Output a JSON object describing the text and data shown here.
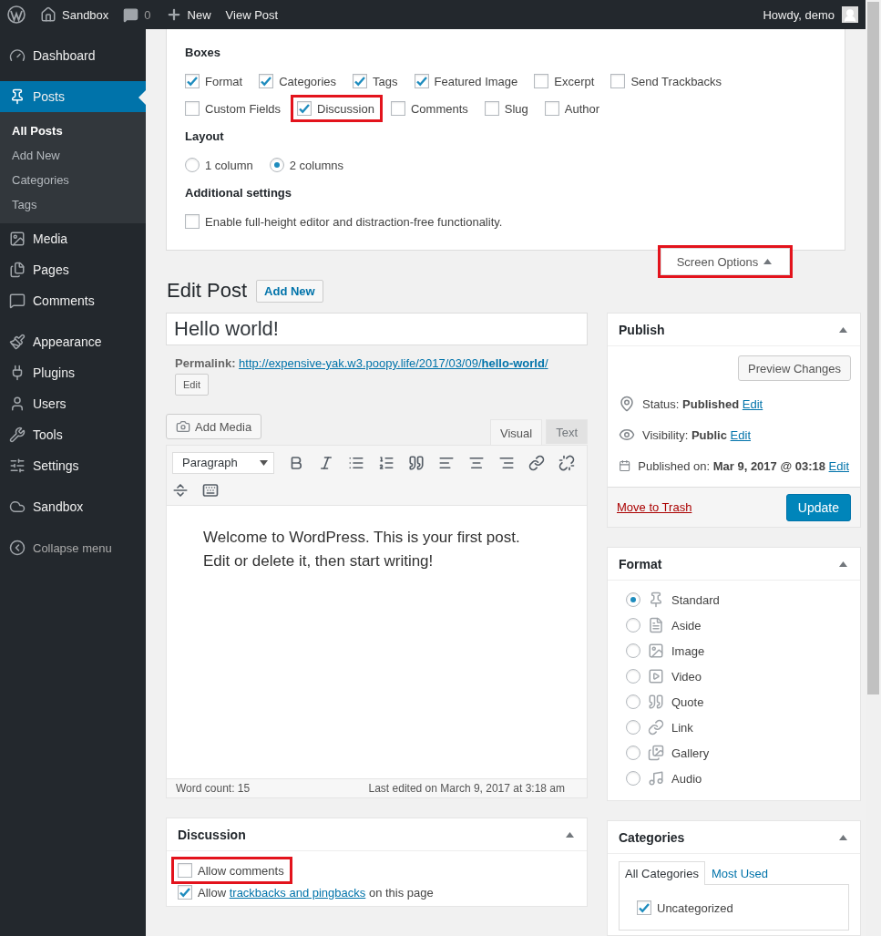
{
  "admin_bar": {
    "site": "Sandbox",
    "comment_count": "0",
    "new_label": "New",
    "view_label": "View Post",
    "greeting": "Howdy, demo"
  },
  "sidebar": {
    "groups": [
      [
        {
          "label": "Dashboard",
          "selected": false
        }
      ],
      [
        {
          "label": "Posts",
          "selected": true,
          "children": [
            {
              "label": "All Posts",
              "selected": true
            },
            {
              "label": "Add New",
              "selected": false
            },
            {
              "label": "Categories",
              "selected": false
            },
            {
              "label": "Tags",
              "selected": false
            }
          ]
        },
        {
          "label": "Media",
          "selected": false
        },
        {
          "label": "Pages",
          "selected": false
        },
        {
          "label": "Comments",
          "selected": false
        }
      ],
      [
        {
          "label": "Appearance",
          "selected": false
        },
        {
          "label": "Plugins",
          "selected": false
        },
        {
          "label": "Users",
          "selected": false
        },
        {
          "label": "Tools",
          "selected": false
        },
        {
          "label": "Settings",
          "selected": false
        }
      ],
      [
        {
          "label": "Sandbox",
          "selected": false
        }
      ]
    ],
    "collapse": "Collapse menu"
  },
  "screen_options": {
    "sections": [
      {
        "heading": "Boxes",
        "kind": "checkboxes",
        "options": [
          {
            "label": "Format",
            "checked": true,
            "highlighted": false
          },
          {
            "label": "Categories",
            "checked": true,
            "highlighted": false
          },
          {
            "label": "Tags",
            "checked": true,
            "highlighted": false
          },
          {
            "label": "Featured Image",
            "checked": true,
            "highlighted": false
          },
          {
            "label": "Excerpt",
            "checked": false,
            "highlighted": false
          },
          {
            "label": "Send Trackbacks",
            "checked": false,
            "highlighted": false
          },
          {
            "label": "Custom Fields",
            "checked": false,
            "highlighted": false
          },
          {
            "label": "Discussion",
            "checked": true,
            "highlighted": true
          },
          {
            "label": "Comments",
            "checked": false,
            "highlighted": false
          },
          {
            "label": "Slug",
            "checked": false,
            "highlighted": false
          },
          {
            "label": "Author",
            "checked": false,
            "highlighted": false
          }
        ]
      },
      {
        "heading": "Layout",
        "kind": "radios",
        "options": [
          {
            "label": "1 column",
            "selected": false
          },
          {
            "label": "2 columns",
            "selected": true
          }
        ]
      },
      {
        "heading": "Additional settings",
        "kind": "checkboxes",
        "options": [
          {
            "label": "Enable full-height editor and distraction-free functionality.",
            "checked": false,
            "highlighted": false
          }
        ]
      }
    ],
    "toggle": {
      "label": "Screen Options",
      "highlighted": true
    }
  },
  "heading": "Edit Post",
  "add_new": "Add New",
  "post": {
    "title": "Hello world!",
    "permalink_label": "Permalink:",
    "permalink": "http://expensive-yak.w3.poopy.life/2017/03/09/**hello-world**/",
    "edit_slug": "Edit"
  },
  "editor": {
    "add_media": "Add Media",
    "tabs": [
      {
        "label": "Visual",
        "selected": true
      },
      {
        "label": "Text",
        "selected": false
      }
    ],
    "format_select": "Paragraph",
    "content": "Welcome to WordPress. This is your first post. Edit or delete it, then start writing!",
    "word_count": "Word count: 15",
    "last_edited": "Last edited on March 9, 2017 at 3:18 am"
  },
  "discussion": {
    "title": "Discussion",
    "options": [
      {
        "label": "Allow comments",
        "checked": false,
        "highlighted": true
      },
      {
        "label": "Allow",
        "link": "trackbacks and pingbacks",
        "after": "on this page",
        "checked": true,
        "highlighted": false
      }
    ]
  },
  "publish": {
    "title": "Publish",
    "preview": "Preview Changes",
    "rows": [
      {
        "text": "Status: **Published**",
        "link": "Edit"
      },
      {
        "text": "Visibility: **Public**",
        "link": "Edit"
      },
      {
        "text": "Published on: **Mar 9, 2017 @ 03:18**",
        "link": "Edit"
      }
    ],
    "trash": "Move to Trash",
    "update": "Update"
  },
  "format": {
    "title": "Format",
    "options": [
      {
        "label": "Standard",
        "selected": true
      },
      {
        "label": "Aside",
        "selected": false
      },
      {
        "label": "Image",
        "selected": false
      },
      {
        "label": "Video",
        "selected": false
      },
      {
        "label": "Quote",
        "selected": false
      },
      {
        "label": "Link",
        "selected": false
      },
      {
        "label": "Gallery",
        "selected": false
      },
      {
        "label": "Audio",
        "selected": false
      }
    ]
  },
  "categories": {
    "title": "Categories",
    "tabs": [
      {
        "label": "All Categories",
        "selected": true
      },
      {
        "label": "Most Used",
        "selected": false
      }
    ],
    "items": [
      {
        "label": "Uncategorized",
        "checked": true
      }
    ]
  }
}
